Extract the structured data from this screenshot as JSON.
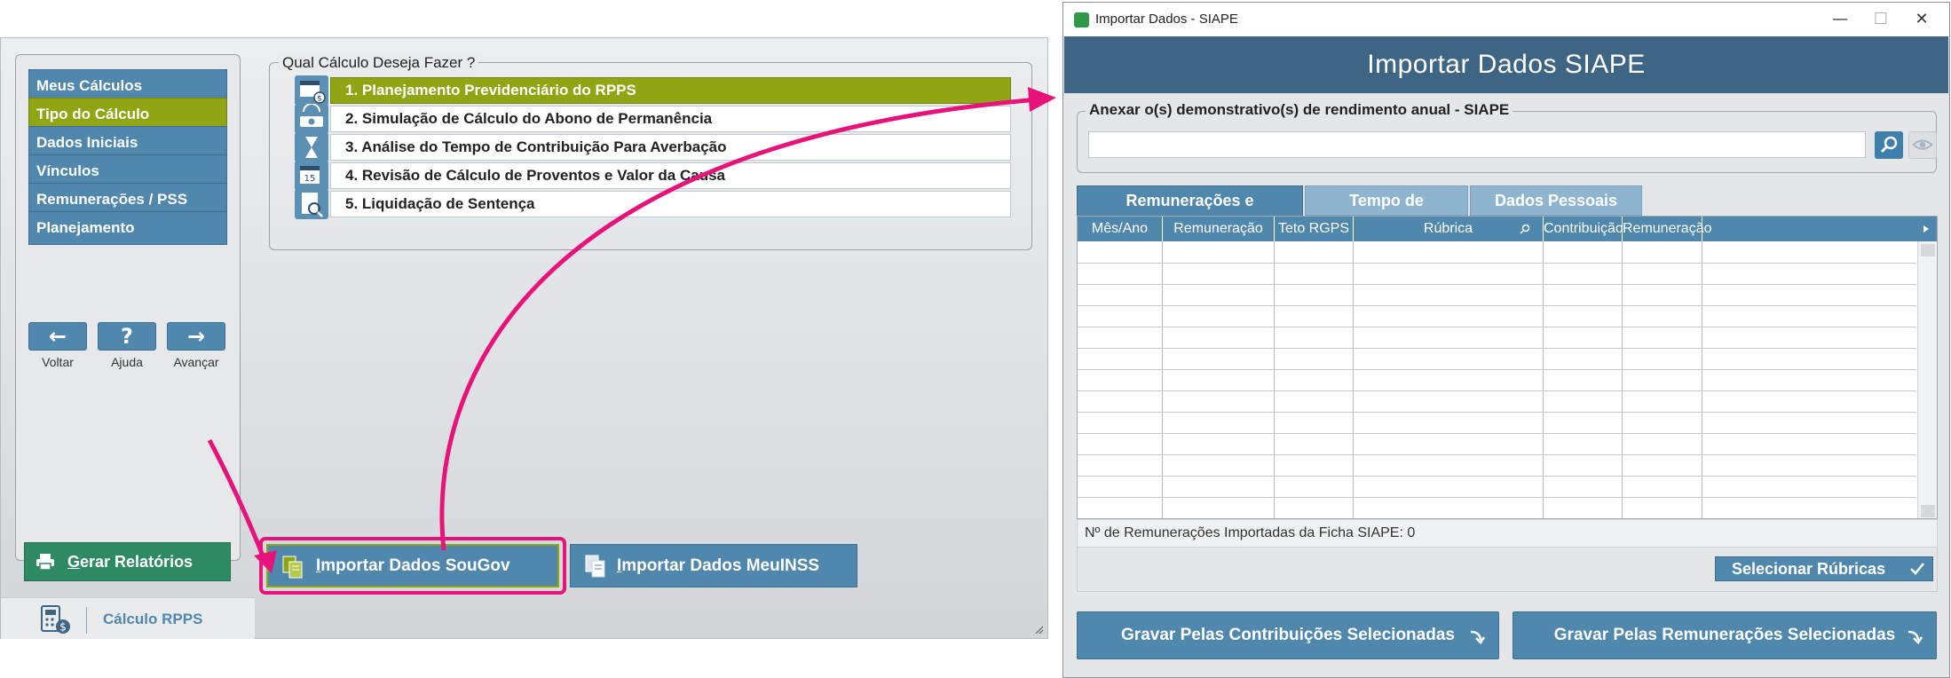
{
  "left_window": {
    "nav": [
      {
        "label": "Meus Cálculos",
        "active": false
      },
      {
        "label": "Tipo do Cálculo",
        "active": true
      },
      {
        "label": "Dados Iniciais",
        "active": false
      },
      {
        "label": "Vínculos",
        "active": false
      },
      {
        "label": "Remunerações / PSS",
        "active": false
      },
      {
        "label": "Planejamento",
        "active": false
      }
    ],
    "small_buttons": [
      {
        "glyph": "←",
        "label": "Voltar"
      },
      {
        "glyph": "?",
        "label": "Ajuda"
      },
      {
        "glyph": "→",
        "label": "Avançar"
      }
    ],
    "gerar_first": "G",
    "gerar_rest": "erar Relatórios",
    "footer_label": "Cálculo RPPS",
    "question_title": "Qual Cálculo Deseja Fazer ?",
    "options": [
      {
        "label": "1. Planejamento Previdenciário do RPPS",
        "selected": true,
        "icon": "calendar-money-icon"
      },
      {
        "label": "2. Simulação de Cálculo do Abono de Permanência",
        "selected": false,
        "icon": "money-cycle-icon"
      },
      {
        "label": "3. Análise do Tempo de Contribuição Para Averbação",
        "selected": false,
        "icon": "hourglass-icon"
      },
      {
        "label": "4. Revisão de Cálculo de Proventos e Valor da Causa",
        "selected": false,
        "icon": "calendar-15-icon"
      },
      {
        "label": "5. Liquidação de Sentença",
        "selected": false,
        "icon": "document-search-icon"
      }
    ],
    "import_sougov_first": "I",
    "import_sougov_rest": "mportar Dados SouGov",
    "import_meuinss_first": "I",
    "import_meuinss_rest": "mportar Dados MeuINSS"
  },
  "dialog": {
    "window_title": "Importar Dados - SIAPE",
    "controls": {
      "minimize": "—",
      "maximize": "☐",
      "close": "✕"
    },
    "header_title": "Importar Dados SIAPE",
    "anexar_title": "Anexar o(s) demonstrativo(s) de rendimento anual - SIAPE",
    "anexar_value": "",
    "tabs": [
      {
        "label": "Remunerações e Contribuições",
        "active": true
      },
      {
        "label": "Tempo de Contribuição",
        "active": false
      },
      {
        "label": "Dados Pessoais",
        "active": false
      }
    ],
    "columns": [
      "Mês/Ano",
      "Remuneração SIAPE",
      "Teto RGPS",
      "Rúbrica",
      "Contribuição",
      "Remuneração"
    ],
    "status_text": "Nº de Remunerações Importadas da Ficha SIAPE: 0",
    "select_rubricas_label": "Selecionar Rúbricas",
    "save_contrib_label": "Gravar Pelas Contribuições Selecionadas",
    "save_remun_label": "Gravar Pelas Remunerações Selecionadas"
  },
  "colors": {
    "primary_blue": "#4f87ad",
    "active_green": "#8fa514",
    "header_blue": "#3f6584",
    "report_green": "#2e8a63",
    "highlight_pink": "#e8137a"
  }
}
